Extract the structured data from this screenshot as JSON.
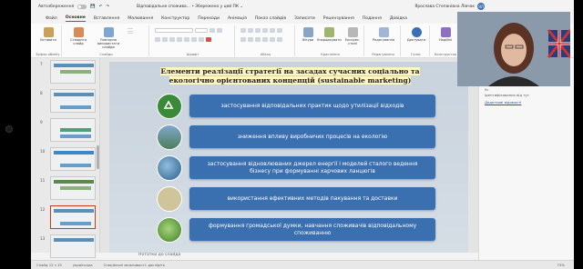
{
  "titlebar": {
    "autosave_label": "Автозбереження",
    "doc_title": "Відповідальне спожива... • Збережено у цей ПК ⌄",
    "user_name": "Ярослава Степанівна Лівчак",
    "user_initials": "ЯЛ"
  },
  "menu": [
    "Файл",
    "Основне",
    "Вставлення",
    "Малювання",
    "Конструктор",
    "Переходи",
    "Анімація",
    "Показ слайдів",
    "Записати",
    "Рецензування",
    "Подання",
    "Довідка"
  ],
  "ribbon": {
    "paste": "Вставити",
    "clipboard": "Буфер обміну",
    "new_slide": "Створити слайд",
    "reuse": "Повторно використати слайди",
    "slides": "Слайди",
    "font": "Шрифт",
    "paragraph": "Абзац",
    "shapes": "Фігури",
    "arrange": "Упорядкувати",
    "quick_styles": "Експрес-стилі",
    "drawing": "Креслення",
    "editing": "Редагування",
    "editing_group": "Редагування",
    "dictate": "Диктувати",
    "voice": "Голос",
    "designer": "Надійні",
    "designer2": "Конструктор",
    "share": "Заг..."
  },
  "slide_numbers": [
    "7",
    "8",
    "9",
    "10",
    "11",
    "12",
    "13"
  ],
  "slide": {
    "title": "Елементи реалізації стратегії на засадах сучасних соціально та екологічно орієнтованих концепцій (sustainable marketing)",
    "items": [
      {
        "text": "застосування відповідальних практик щодо утилізації відходів",
        "icon": "recycle-icon",
        "color": "#3a8a3a"
      },
      {
        "text": "зниження впливу виробничих процесів на екологію",
        "icon": "landscape-icon",
        "color": "#4f7da5"
      },
      {
        "text": "застосування відновлюваних джерел енергії і моделей сталого ведення бізнесу при формуванні харчових ланцюгів",
        "icon": "earth-icon",
        "color": "#2d5f8a"
      },
      {
        "text": "використання ефективних методів пакування та доставки",
        "icon": "eco-pack-icon",
        "color": "#b7aa7d"
      },
      {
        "text": "формування громадської думки, навчання споживачів відповідальному споживанню",
        "icon": "globe-leaf-icon",
        "color": "#5b9a3a"
      }
    ]
  },
  "notes": "Нотатки до слайда",
  "status": {
    "slide": "Слайд 12 з 15",
    "lang": "українська",
    "accessibility": "Спеціальні можливості: дослідіть",
    "zoom": "73%"
  },
  "right_pane": {
    "header": "Д",
    "line1": "Ре",
    "line2": "Ус",
    "line3": "ідентифікованих від тут.",
    "link": "Додаткові відомості"
  }
}
